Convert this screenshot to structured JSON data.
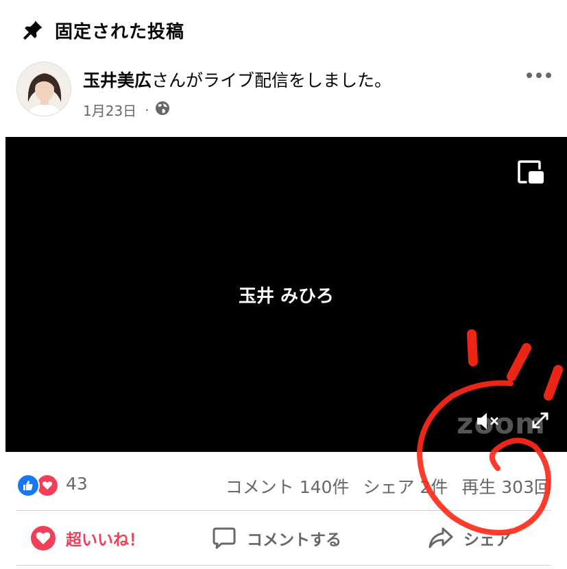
{
  "pinned": {
    "title": "固定された投稿",
    "icon": "pin-icon"
  },
  "post": {
    "author_name": "玉井美広",
    "action_text": "さんがライブ配信をしました。",
    "date": "1月23日",
    "separator": "·",
    "privacy_icon": "globe-icon"
  },
  "video": {
    "name_text": "玉井 みひろ",
    "watermark": "zoom"
  },
  "stats": {
    "reaction_count": "43",
    "comments": "コメント 140件",
    "shares": "シェア 2件",
    "views": "再生 303回"
  },
  "actions": {
    "love_label": "超いいね！",
    "comment_label": "コメントする",
    "share_label": "シェア"
  },
  "colors": {
    "facebook_blue": "#1877f2",
    "love_red": "#f33e58",
    "muted_text": "#65676b",
    "annotation_red": "#ff2a1a"
  }
}
